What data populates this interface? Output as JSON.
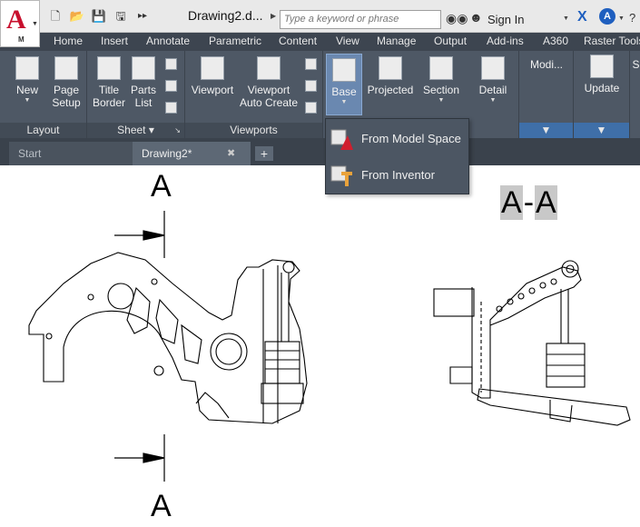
{
  "titlebar": {
    "doc_title": "Drawing2.d...",
    "search_placeholder": "Type a keyword or phrase",
    "sign_in": "Sign In",
    "app_letter": "A",
    "app_sub": "M"
  },
  "menu_tabs": [
    "Home",
    "Insert",
    "Annotate",
    "Parametric",
    "Content",
    "View",
    "Manage",
    "Output",
    "Add-ins",
    "A360",
    "Raster Tools"
  ],
  "ribbon": {
    "panels": {
      "layout": "Layout",
      "sheet": "Sheet",
      "viewports": "Viewports",
      "modify": "Modi...",
      "update_panel": ""
    },
    "buttons": {
      "new": "New",
      "page_setup_1": "Page",
      "page_setup_2": "Setup",
      "title_border_1": "Title",
      "title_border_2": "Border",
      "parts_list_1": "Parts",
      "parts_list_2": "List",
      "viewport": "Viewport",
      "viewport_auto_1": "Viewport",
      "viewport_auto_2": "Auto Create",
      "base": "Base",
      "projected": "Projected",
      "section": "Section",
      "detail": "Detail",
      "update": "Update",
      "extra": "S"
    }
  },
  "doc_tabs": {
    "start": "Start",
    "drawing": "Drawing2*"
  },
  "dropdown": {
    "items": [
      "From Model Space",
      "From Inventor"
    ]
  },
  "canvas": {
    "top_letter": "A",
    "bottom_letter": "A",
    "section_label_left": "A",
    "section_label_dash": "-",
    "section_label_right": "A"
  },
  "colors": {
    "ribbon": "#4e5865",
    "menubar": "#3d4550",
    "accent_red": "#c8102e",
    "accent_blue": "#1f5fbf"
  }
}
